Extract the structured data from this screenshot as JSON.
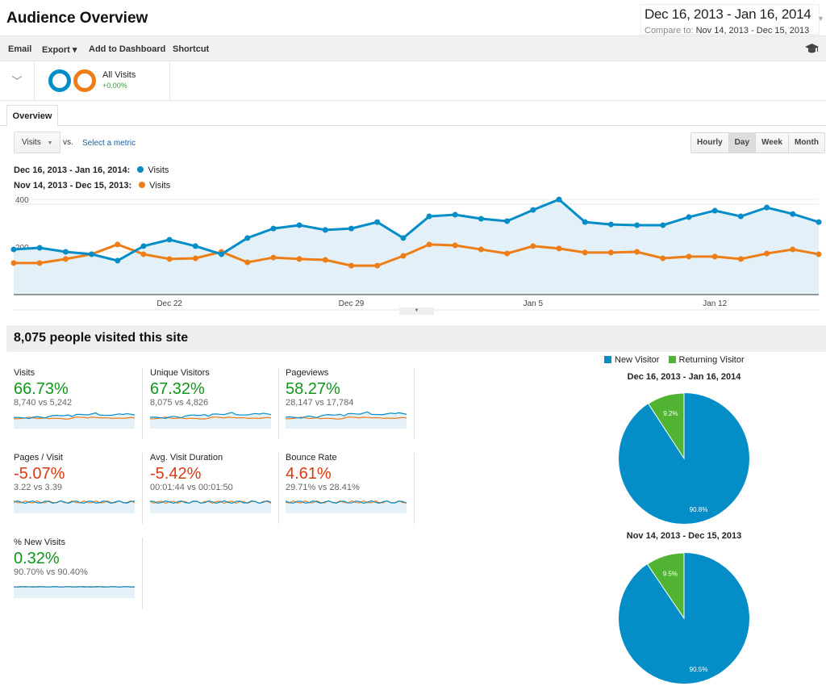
{
  "header": {
    "title": "Audience Overview",
    "date_range": "Dec 16, 2013 - Jan 16, 2014",
    "compare_label": "Compare to:",
    "compare_range": "Nov 14, 2013 - Dec 15, 2013"
  },
  "toolbar": {
    "email": "Email",
    "export": "Export ▾",
    "add_to_dashboard": "Add to Dashboard",
    "shortcut": "Shortcut",
    "help_icon": "graduation-cap-icon"
  },
  "segment": {
    "name": "All Visits",
    "change": "+0.00%"
  },
  "tabs": [
    {
      "label": "Overview",
      "active": true
    }
  ],
  "controls": {
    "metric": "Visits",
    "vs": "vs.",
    "select_metric": "Select a metric",
    "granularity": [
      "Hourly",
      "Day",
      "Week",
      "Month"
    ],
    "granularity_selected": "Day"
  },
  "legend": [
    {
      "range": "Dec 16, 2013 - Jan 16, 2014:",
      "series": "Visits",
      "color": "#058dc7"
    },
    {
      "range": "Nov 14, 2013 - Dec 15, 2013:",
      "series": "Visits",
      "color": "#ed7e17"
    }
  ],
  "chart_data": {
    "type": "line",
    "x_tick_labels": [
      "Dec 22",
      "Dec 29",
      "Jan 5",
      "Jan 12"
    ],
    "x_tick_index": [
      6,
      13,
      20,
      27
    ],
    "y_tick_labels": [
      "400",
      "200"
    ],
    "y_ticks": [
      400,
      200
    ],
    "ylim": [
      0,
      440
    ],
    "grid": true,
    "series": [
      {
        "name": "Visits",
        "period": "Dec 16, 2013 - Jan 16, 2014",
        "color": "#058dc7",
        "area": true,
        "values": [
          210,
          217,
          200,
          190,
          163,
          224,
          251,
          224,
          190,
          258,
          298,
          312,
          292,
          298,
          325,
          258,
          349,
          356,
          339,
          329,
          376,
          420,
          325,
          315,
          312,
          312,
          346,
          373,
          349,
          386,
          359,
          325
        ]
      },
      {
        "name": "Visits",
        "period": "Nov 14, 2013 - Dec 15, 2013",
        "color": "#ed7e17",
        "area": false,
        "values": [
          153,
          153,
          170,
          190,
          231,
          190,
          170,
          173,
          200,
          156,
          176,
          170,
          166,
          142,
          142,
          183,
          231,
          227,
          210,
          193,
          224,
          214,
          197,
          197,
          200,
          173,
          180,
          180,
          170,
          193,
          210,
          190
        ]
      }
    ]
  },
  "summary": {
    "headline": "8,075 people visited this site"
  },
  "metrics": [
    {
      "label": "Visits",
      "change": "66.73%",
      "trend": "positive",
      "comparison": "8,740 vs 5,242"
    },
    {
      "label": "Unique Visitors",
      "change": "67.32%",
      "trend": "positive",
      "comparison": "8,075 vs 4,826"
    },
    {
      "label": "Pageviews",
      "change": "58.27%",
      "trend": "positive",
      "comparison": "28,147 vs 17,784"
    },
    {
      "label": "Pages / Visit",
      "change": "-5.07%",
      "trend": "negative",
      "comparison": "3.22 vs 3.39"
    },
    {
      "label": "Avg. Visit Duration",
      "change": "-5.42%",
      "trend": "negative",
      "comparison": "00:01:44 vs 00:01:50"
    },
    {
      "label": "Bounce Rate",
      "change": "4.61%",
      "trend": "negative",
      "comparison": "29.71% vs 28.41%"
    },
    {
      "label": "% New Visits",
      "change": "0.32%",
      "trend": "positive",
      "comparison": "90.70% vs 90.40%"
    }
  ],
  "colors": {
    "positive": "#109618",
    "negative": "#dc3912",
    "new_visitor": "#058dc7",
    "returning_visitor": "#50b432"
  },
  "pies": {
    "legend": [
      "New Visitor",
      "Returning Visitor"
    ],
    "charts": [
      {
        "title": "Dec 16, 2013 - Jan 16, 2014",
        "new_pct": 90.8,
        "returning_pct": 9.2,
        "new_label": "90.8%",
        "returning_label": "9.2%"
      },
      {
        "title": "Nov 14, 2013 - Dec 15, 2013",
        "new_pct": 90.5,
        "returning_pct": 9.5,
        "new_label": "90.5%",
        "returning_label": "9.5%"
      }
    ]
  }
}
